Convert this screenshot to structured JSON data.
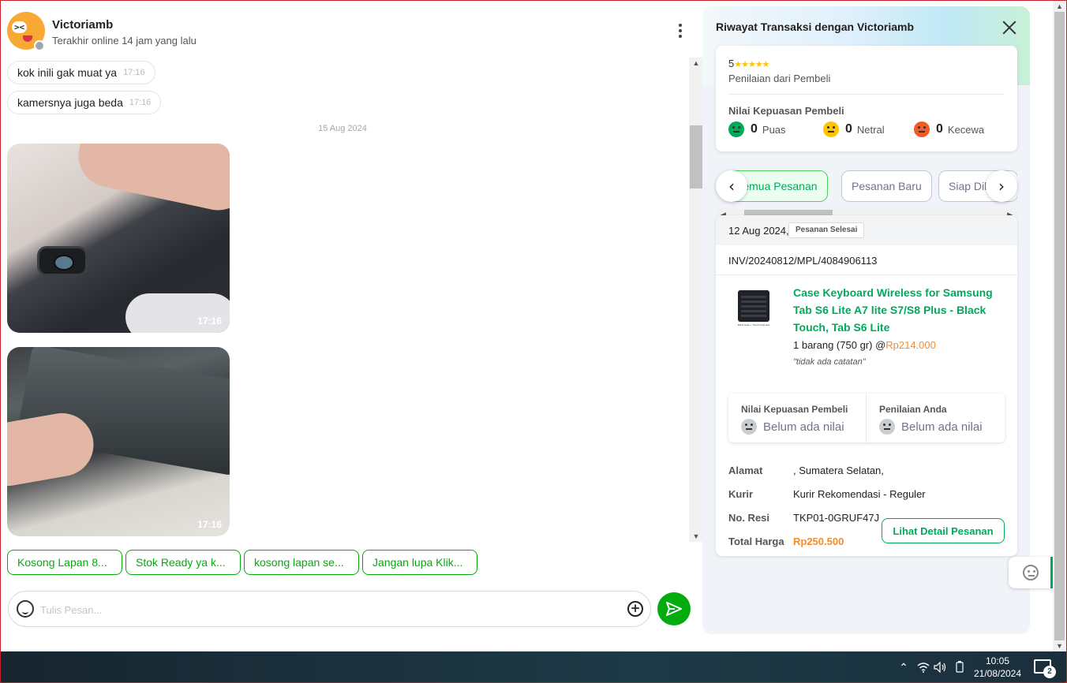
{
  "chat": {
    "name": "Victoriamb",
    "status": "Terakhir online 14 jam yang lalu",
    "messages": [
      {
        "text": "kok inili gak muat ya",
        "time": "17:16"
      },
      {
        "text": "kamersnya juga beda",
        "time": "17:16"
      }
    ],
    "date_separator": "15 Aug 2024",
    "photos": [
      {
        "time": "17:16"
      },
      {
        "time": "17:16"
      }
    ],
    "quick_replies": [
      "Kosong Lapan 8...",
      "Stok Ready ya k...",
      "kosong lapan se...",
      "Jangan lupa Klik..."
    ],
    "input_placeholder": "Tulis Pesan..."
  },
  "panel": {
    "title": "Riwayat Transaksi dengan Victoriamb",
    "rating_value": "5",
    "rating_stars": "★★★★★",
    "rating_label": "Penilaian dari Pembeli",
    "satisfaction_title": "Nilai Kepuasan Pembeli",
    "satisfaction": [
      {
        "count": "0",
        "label": "Puas",
        "color": "#00aa5b"
      },
      {
        "count": "0",
        "label": "Netral",
        "color": "#ffc400"
      },
      {
        "count": "0",
        "label": "Kecewa",
        "color": "#f15a22"
      }
    ],
    "tabs": [
      "Semua Pesanan",
      "Pesanan Baru",
      "Siap Dikirim"
    ],
    "active_tab": "Semua Pesanan",
    "order": {
      "date": "12 Aug 2024,",
      "status": "Pesanan Selesai",
      "invoice": "INV/20240812/MPL/4084906113",
      "product_name": "Case Keyboard Wireless for Samsung Tab S6 Lite A7 lite S7/S8 Plus - Black Touch, Tab S6 Lite",
      "image_caption": "Black Case + Touch Keyboard",
      "quantity": "1 barang (750 gr) @",
      "unit_price": "Rp214.000",
      "note": "\"tidak ada catatan\"",
      "buyer_rating_title": "Nilai Kepuasan Pembeli",
      "buyer_rating_value": "Belum ada nilai",
      "your_rating_title": "Penilaian Anda",
      "your_rating_value": "Belum ada nilai",
      "address_label": "Alamat",
      "address_value": ", Sumatera Selatan,",
      "courier_label": "Kurir",
      "courier_value": "Kurir Rekomendasi - Reguler",
      "receipt_label": "No. Resi",
      "receipt_value": "TKP01-0GRUF47J",
      "total_label": "Total Harga",
      "total_value": "Rp250.500",
      "detail_button": "Lihat Detail Pesanan"
    }
  },
  "taskbar": {
    "time": "10:05",
    "date": "21/08/2024",
    "notification_count": "2"
  },
  "colors": {
    "accent": "#03ac0e",
    "price": "#f58c2c"
  }
}
